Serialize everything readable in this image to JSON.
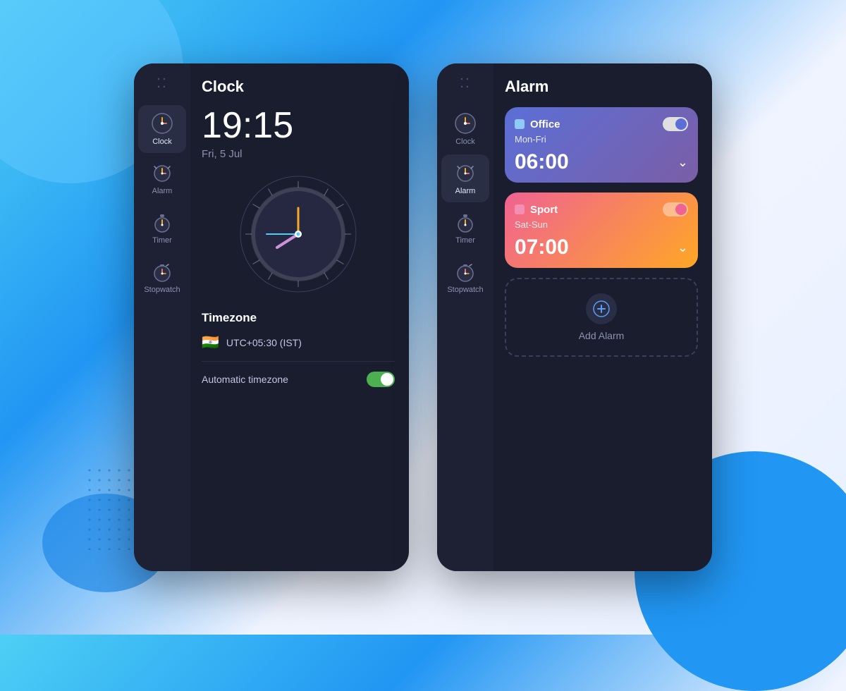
{
  "background": {
    "color": "#e8f0ff"
  },
  "phone1": {
    "title": "Clock",
    "drag_icon": "····",
    "sidebar": {
      "items": [
        {
          "id": "clock",
          "label": "Clock",
          "active": true
        },
        {
          "id": "alarm",
          "label": "Alarm",
          "active": false
        },
        {
          "id": "timer",
          "label": "Timer",
          "active": false
        },
        {
          "id": "stopwatch",
          "label": "Stopwatch",
          "active": false
        }
      ]
    },
    "clock": {
      "time": "19:15",
      "date": "Fri, 5 Jul",
      "timezone_section": "Timezone",
      "flag": "🇮🇳",
      "timezone_value": "UTC+05:30 (IST)",
      "auto_timezone_label": "Automatic timezone",
      "auto_timezone_on": true
    }
  },
  "phone2": {
    "title": "Alarm",
    "drag_icon": "····",
    "sidebar": {
      "items": [
        {
          "id": "clock",
          "label": "Clock",
          "active": false
        },
        {
          "id": "alarm",
          "label": "Alarm",
          "active": true
        },
        {
          "id": "timer",
          "label": "Timer",
          "active": false
        },
        {
          "id": "stopwatch",
          "label": "Stopwatch",
          "active": false
        }
      ]
    },
    "alarms": [
      {
        "id": "office",
        "name": "Office",
        "days": "Mon-Fri",
        "time": "06:00",
        "enabled": true,
        "style": "office"
      },
      {
        "id": "sport",
        "name": "Sport",
        "days": "Sat-Sun",
        "time": "07:00",
        "enabled": true,
        "style": "sport"
      }
    ],
    "add_alarm_label": "Add Alarm"
  }
}
